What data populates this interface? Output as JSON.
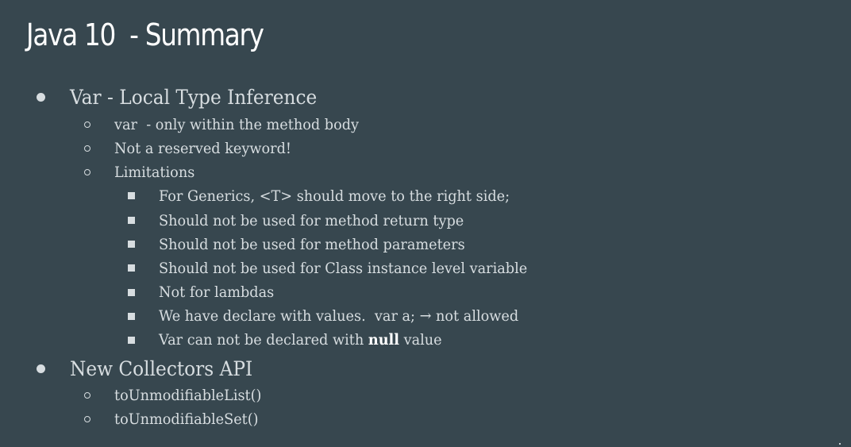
{
  "slide": {
    "title": "Java 10  - Summary",
    "sections": [
      {
        "label": "Var - Local Type Inference",
        "items": [
          {
            "label": "var  - only within the method body"
          },
          {
            "label": "Not a reserved keyword!"
          },
          {
            "label": "Limitations",
            "subitems": [
              "For Generics, <T> should move to the right side;",
              "Should not be used for method return type",
              "Should not be used for method parameters",
              "Should not be used for Class instance level variable",
              "Not for lambdas",
              "We have declare with values.  var a; → not allowed"
            ],
            "last_subitem": {
              "before": "Var can not be declared with ",
              "bold": "null",
              "after": " value"
            }
          }
        ]
      },
      {
        "label": "New Collectors API",
        "items": [
          {
            "label": "toUnmodifiableList()"
          },
          {
            "label": "toUnmodifiableSet()"
          }
        ]
      }
    ]
  }
}
